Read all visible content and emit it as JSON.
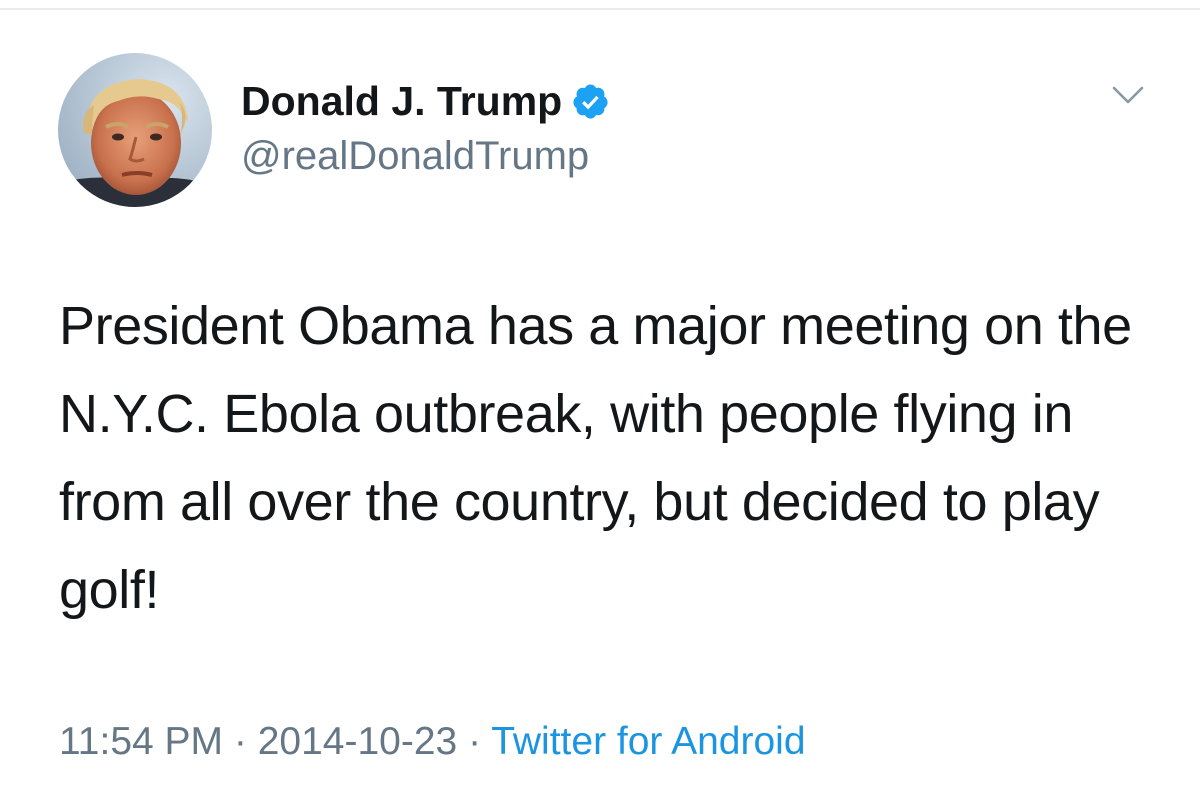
{
  "author": {
    "display_name": "Donald J. Trump",
    "handle": "@realDonaldTrump",
    "verified": true,
    "avatar_icon": "profile-photo"
  },
  "menu": {
    "icon": "chevron-down-icon"
  },
  "tweet": {
    "text": "President Obama has a major meeting on the N.Y.C. Ebola outbreak, with people flying in from all over the country, but decided to play golf!"
  },
  "meta": {
    "time": "11:54 PM",
    "separator": "·",
    "date": "2014-10-23",
    "source": "Twitter for Android"
  },
  "colors": {
    "primary_text": "#14171a",
    "secondary_text": "#657786",
    "accent": "#1b95e0",
    "verified_badge": "#1da1f2",
    "divider": "#e6ecf0"
  }
}
